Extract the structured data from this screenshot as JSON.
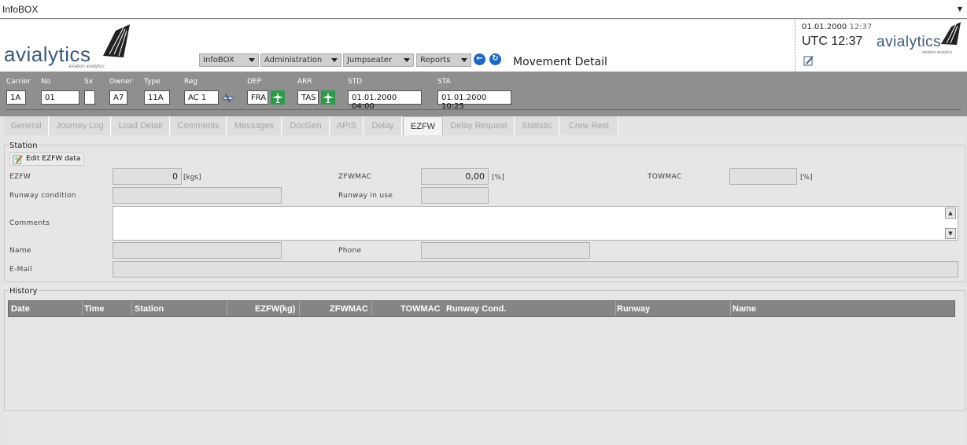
{
  "window": {
    "title": "InfoBOX"
  },
  "header": {
    "logo_text": "avialytics",
    "logo_sub": "aviation analytics",
    "menus": [
      {
        "label": "InfoBOX"
      },
      {
        "label": "Administration"
      },
      {
        "label": "Jumpseater"
      },
      {
        "label": "Reports"
      }
    ],
    "page_title": "Movement Detail",
    "date": "01.01.2000",
    "time": "12:37",
    "utc": "UTC 12:37"
  },
  "flight": {
    "carrier": {
      "label": "Carrier",
      "value": "1A"
    },
    "no": {
      "label": "No",
      "value": "01"
    },
    "sx": {
      "label": "Sx",
      "value": ""
    },
    "owner": {
      "label": "Owner",
      "value": "A7"
    },
    "type": {
      "label": "Type",
      "value": "11A"
    },
    "reg": {
      "label": "Reg",
      "value": "AC 1"
    },
    "dep": {
      "label": "DEP",
      "value": "FRA"
    },
    "arr": {
      "label": "ARR",
      "value": "TAS"
    },
    "std": {
      "label": "STD",
      "value": "01.01.2000 04:00"
    },
    "sta": {
      "label": "STA",
      "value": "01.01.2000 10:25"
    }
  },
  "tabs": [
    {
      "label": "General"
    },
    {
      "label": "Journey Log"
    },
    {
      "label": "Load Detail"
    },
    {
      "label": "Comments"
    },
    {
      "label": "Messages"
    },
    {
      "label": "DocGen"
    },
    {
      "label": "APIS"
    },
    {
      "label": "Delay"
    },
    {
      "label": "EZFW"
    },
    {
      "label": "Delay Request"
    },
    {
      "label": "Statistic"
    },
    {
      "label": "Crew Rest"
    }
  ],
  "active_tab": "EZFW",
  "station": {
    "title": "Station",
    "edit_button": "Edit EZFW data",
    "ezfw_label": "EZFW",
    "ezfw_value": "0",
    "ezfw_unit": "[kgs]",
    "zfwmac_label": "ZFWMAC",
    "zfwmac_value": "0,00",
    "zfwmac_unit": "[%]",
    "towmac_label": "TOWMAC",
    "towmac_value": "",
    "towmac_unit": "[%]",
    "runway_condition_label": "Runway condition",
    "runway_condition_value": "",
    "runway_in_use_label": "Runway in use",
    "runway_in_use_value": "",
    "comments_label": "Comments",
    "name_label": "Name",
    "name_value": "",
    "phone_label": "Phone",
    "phone_value": "",
    "email_label": "E-Mail",
    "email_value": ""
  },
  "history": {
    "title": "History",
    "columns": [
      "Date",
      "Time",
      "Station",
      "EZFW(kg)",
      "ZFWMAC",
      "TOWMAC",
      "Runway Cond.",
      "Runway",
      "Name"
    ],
    "rows": []
  },
  "colors": {
    "accent": "#1f67c4",
    "plane": "#2e9a4a",
    "header_bar": "#8f8f8f"
  }
}
